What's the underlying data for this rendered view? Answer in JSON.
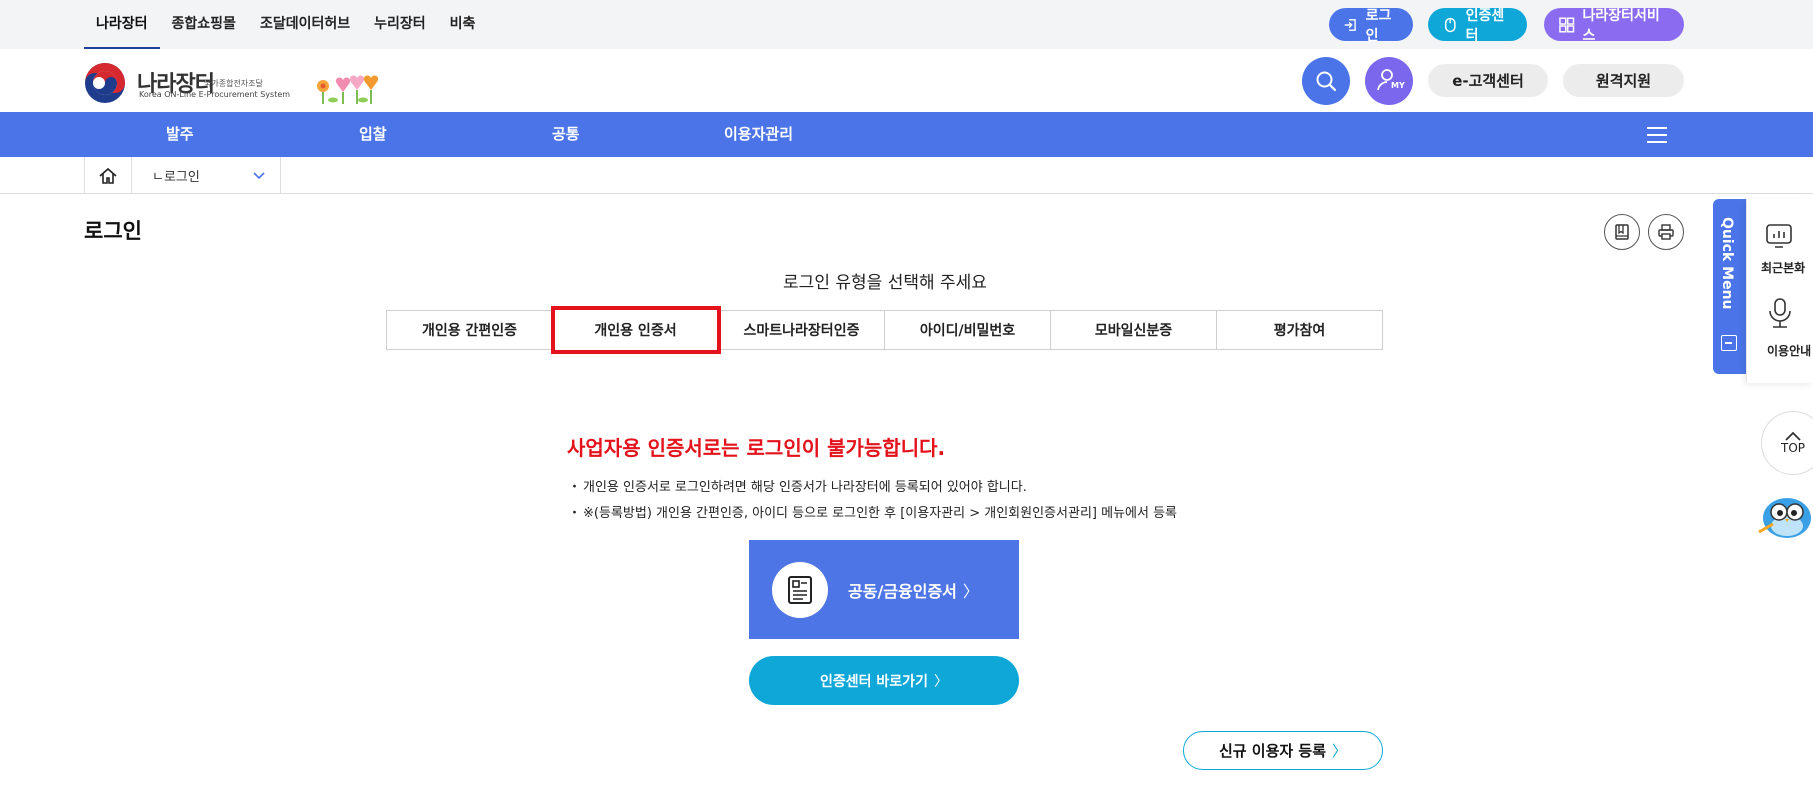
{
  "topbar": {
    "nav": [
      "나라장터",
      "종합쇼핑몰",
      "조달데이터허브",
      "누리장터",
      "비축"
    ],
    "login_label": "로그인",
    "cert_center_label": "인증센터",
    "services_label": "나라장터서비스"
  },
  "header": {
    "logo_kr": "나라장터",
    "logo_sub": "국가종합전자조달",
    "logo_en": "Korea ON-Line E-Procurement System",
    "my_label": "MY",
    "customer_center": "e-고객센터",
    "remote_support": "원격지원"
  },
  "gnb": {
    "menu": [
      "발주",
      "입찰",
      "공통",
      "이용자관리"
    ]
  },
  "breadcrumb": {
    "current": "ㄴ로그인"
  },
  "page": {
    "title": "로그인",
    "subtitle": "로그인 유형을 선택해 주세요"
  },
  "tabs": [
    {
      "label": "개인용 간편인증",
      "selected": false
    },
    {
      "label": "개인용 인증서",
      "selected": true
    },
    {
      "label": "스마트나라장터인증",
      "selected": false
    },
    {
      "label": "아이디/비밀번호",
      "selected": false
    },
    {
      "label": "모바일신분증",
      "selected": false
    },
    {
      "label": "평가참여",
      "selected": false
    }
  ],
  "content": {
    "warning": "사업자용 인증서로는 로그인이 불가능합니다.",
    "notes": [
      "개인용 인증서로 로그인하려면 해당 인증서가 나라장터에 등록되어 있어야 합니다.",
      "※(등록방법) 개인용 간편인증, 아이디 등으로 로그인한 후 [이용자관리 > 개인회원인증서관리] 메뉴에서 등록"
    ],
    "cert_button": "공동/금융인증서",
    "cert_center_button": "인증센터 바로가기",
    "new_user_button": "신규 이용자 등록"
  },
  "quick_menu": {
    "title": "Quick Menu",
    "recent": "최근본화",
    "guide": "이용안내",
    "top": "TOP"
  },
  "colors": {
    "primary_blue": "#4a74e8",
    "cyan": "#0ea7d8",
    "purple": "#8b6cf0",
    "warning_red": "#e3121b"
  }
}
